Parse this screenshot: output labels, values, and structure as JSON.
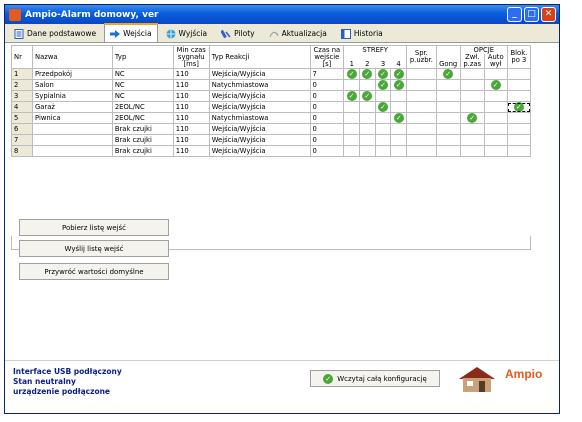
{
  "window": {
    "title": "Ampio-Alarm domowy, ver"
  },
  "tabs": [
    {
      "label": "Dane podstawowe",
      "active": false,
      "icon": "document-icon"
    },
    {
      "label": "Wejścia",
      "active": true,
      "icon": "arrow-right-icon"
    },
    {
      "label": "Wyjścia",
      "active": false,
      "icon": "globe-icon"
    },
    {
      "label": "Piloty",
      "active": false,
      "icon": "remote-icon"
    },
    {
      "label": "Aktualizacja",
      "active": false,
      "icon": "update-icon"
    },
    {
      "label": "Historia",
      "active": false,
      "icon": "history-icon"
    }
  ],
  "table": {
    "headers": {
      "nr": "Nr",
      "nazwa": "Nazwa",
      "typ": "Typ",
      "min_czas_1": "Min czas",
      "min_czas_2": "sygnału",
      "min_czas_3": "[ms]",
      "typ_reakcji": "Typ Reakcji",
      "czas_1": "Czas na",
      "czas_2": "wejście",
      "czas_3": "[s]",
      "strefy": "STREFY",
      "s1": "1",
      "s2": "2",
      "s3": "3",
      "s4": "4",
      "spr_1": "Spr.",
      "spr_2": "p.uzbr.",
      "gong": "Gong",
      "opcje": "OPCJE",
      "zwl_1": "Zwł.",
      "zwl_2": "p.zas",
      "auto_1": "Auto",
      "auto_2": "wył",
      "blok_1": "Blok.",
      "blok_2": "po 3"
    },
    "rows": [
      {
        "nr": "1",
        "nazwa": "Przedpokój",
        "typ": "NC",
        "min": "110",
        "reakcja": "Wejścia/Wyjścia",
        "czas": "7",
        "s": [
          true,
          true,
          true,
          true
        ],
        "spr": false,
        "gong": true,
        "zwl": false,
        "auto": false,
        "blok": false
      },
      {
        "nr": "2",
        "nazwa": "Salon",
        "typ": "NC",
        "min": "110",
        "reakcja": "Natychmiastowa",
        "czas": "0",
        "s": [
          false,
          false,
          true,
          true
        ],
        "spr": false,
        "gong": false,
        "zwl": false,
        "auto": true,
        "blok": false
      },
      {
        "nr": "3",
        "nazwa": "Sypialnia",
        "typ": "NC",
        "min": "110",
        "reakcja": "Wejścia/Wyjścia",
        "czas": "0",
        "s": [
          true,
          true,
          false,
          false
        ],
        "spr": false,
        "gong": false,
        "zwl": false,
        "auto": false,
        "blok": false
      },
      {
        "nr": "4",
        "nazwa": "Garaż",
        "typ": "2EOL/NC",
        "min": "110",
        "reakcja": "Wejścia/Wyjścia",
        "czas": "0",
        "s": [
          false,
          false,
          true,
          false
        ],
        "spr": false,
        "gong": false,
        "zwl": false,
        "auto": false,
        "blok": true
      },
      {
        "nr": "5",
        "nazwa": "Piwnica",
        "typ": "2EOL/NC",
        "min": "110",
        "reakcja": "Natychmiastowa",
        "czas": "0",
        "s": [
          false,
          false,
          false,
          true
        ],
        "spr": false,
        "gong": false,
        "zwl": true,
        "auto": false,
        "blok": false
      },
      {
        "nr": "6",
        "nazwa": "",
        "typ": "Brak czujki",
        "min": "110",
        "reakcja": "Wejścia/Wyjścia",
        "czas": "0",
        "s": [
          false,
          false,
          false,
          false
        ],
        "spr": false,
        "gong": false,
        "zwl": false,
        "auto": false,
        "blok": false
      },
      {
        "nr": "7",
        "nazwa": "",
        "typ": "Brak czujki",
        "min": "110",
        "reakcja": "Wejścia/Wyjścia",
        "czas": "0",
        "s": [
          false,
          false,
          false,
          false
        ],
        "spr": false,
        "gong": false,
        "zwl": false,
        "auto": false,
        "blok": false
      },
      {
        "nr": "8",
        "nazwa": "",
        "typ": "Brak czujki",
        "min": "110",
        "reakcja": "Wejścia/Wyjścia",
        "czas": "0",
        "s": [
          false,
          false,
          false,
          false
        ],
        "spr": false,
        "gong": false,
        "zwl": false,
        "auto": false,
        "blok": false
      }
    ]
  },
  "buttons": {
    "pobierz": "Pobierz listę wejść",
    "wyslij": "Wyślij listę wejść",
    "przywroc": "Przywróć wartości domyślne",
    "wczytaj": "Wczytaj całą konfigurację"
  },
  "status": {
    "line1": "Interface USB podłączony",
    "line2": "Stan neutralny",
    "line3": "urządzenie podłączone"
  },
  "logo": "Ampio",
  "colors": {
    "title_bar": "#0a5ddb",
    "check": "#4aa838",
    "status_text": "#0a1e8c",
    "logo": "#e35b1e"
  }
}
